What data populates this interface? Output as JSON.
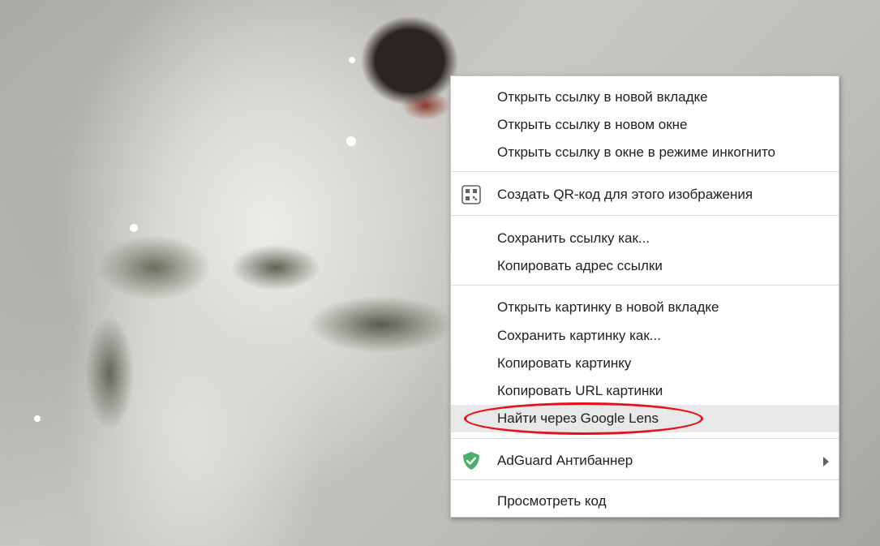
{
  "context_menu": {
    "groups": [
      {
        "items": [
          {
            "label": "Открыть ссылку в новой вкладке"
          },
          {
            "label": "Открыть ссылку в новом окне"
          },
          {
            "label": "Открыть ссылку в окне в режиме инкогнито"
          }
        ]
      },
      {
        "items": [
          {
            "label": "Создать QR-код для этого изображения",
            "icon": "qr-code-icon"
          }
        ]
      },
      {
        "items": [
          {
            "label": "Сохранить ссылку как..."
          },
          {
            "label": "Копировать адрес ссылки"
          }
        ]
      },
      {
        "items": [
          {
            "label": "Открыть картинку в новой вкладке"
          },
          {
            "label": "Сохранить картинку как..."
          },
          {
            "label": "Копировать картинку"
          },
          {
            "label": "Копировать URL картинки"
          },
          {
            "label": "Найти через Google Lens",
            "highlighted": true
          }
        ]
      },
      {
        "items": [
          {
            "label": "AdGuard Антибаннер",
            "icon": "adguard-shield-icon",
            "submenu": true
          }
        ]
      },
      {
        "items": [
          {
            "label": "Просмотреть код"
          }
        ]
      }
    ]
  },
  "colors": {
    "menu_background": "#ffffff",
    "highlight": "#e8e8e8",
    "annotation": "#e8101c",
    "adguard_green": "#4caf6a"
  }
}
